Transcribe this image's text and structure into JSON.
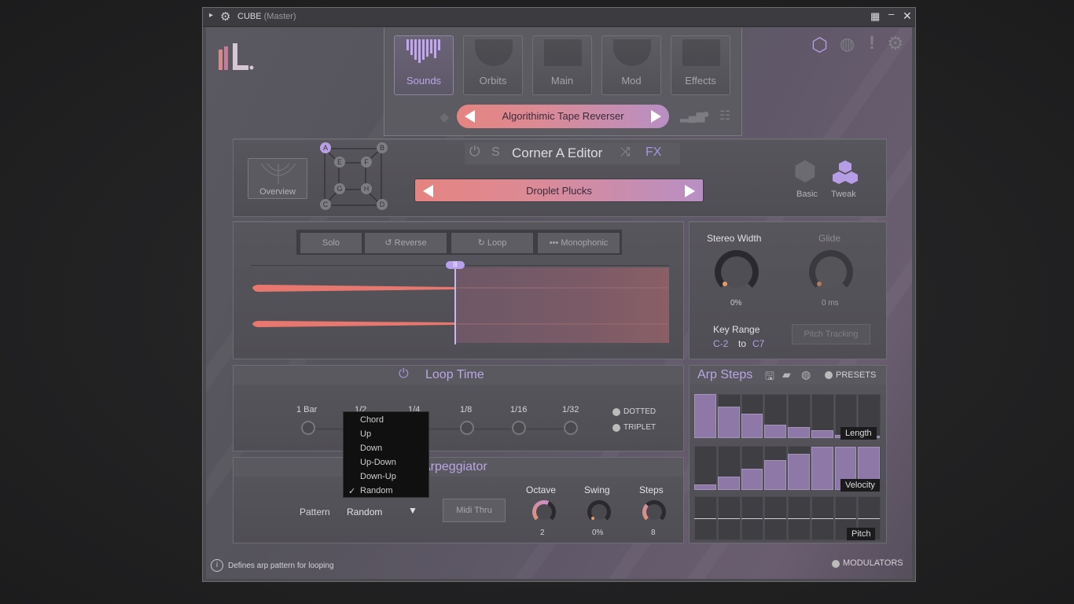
{
  "window": {
    "title": "CUBE",
    "subtitle": "(Master)"
  },
  "nav": {
    "tabs": [
      {
        "label": "Sounds",
        "active": true
      },
      {
        "label": "Orbits"
      },
      {
        "label": "Main"
      },
      {
        "label": "Mod"
      },
      {
        "label": "Effects"
      }
    ],
    "preset": "Algorithimic Tape Reverser"
  },
  "corner": {
    "s_label": "S",
    "title": "Corner A Editor",
    "fx_label": "FX",
    "overview_label": "Overview",
    "nodes": [
      "A",
      "B",
      "E",
      "F",
      "G",
      "H",
      "C",
      "D"
    ],
    "preset": "Droplet Plucks",
    "basic_label": "Basic",
    "tweak_label": "Tweak"
  },
  "sample": {
    "solo": "Solo",
    "reverse": "Reverse",
    "loop": "Loop",
    "mono": "Monophonic",
    "playhead_label": "|||"
  },
  "stereo": {
    "width_label": "Stereo Width",
    "width_value": "0%",
    "glide_label": "Glide",
    "glide_value": "0 ms",
    "key_range_label": "Key Range",
    "key_from": "C-2",
    "key_to_word": "to",
    "key_to": "C7",
    "pitch_tracking": "Pitch Tracking"
  },
  "loop": {
    "title": "Loop Time",
    "divisions": [
      "1 Bar",
      "1/2",
      "1/4",
      "1/8",
      "1/16",
      "1/32"
    ],
    "dotted": "DOTTED",
    "triplet": "TRIPLET"
  },
  "arp": {
    "title": "Arpeggiator",
    "pattern_label": "Pattern",
    "pattern_value": "Random",
    "dropdown_arrow": "▼",
    "midi_thru": "Midi Thru",
    "octave_label": "Octave",
    "octave_value": "2",
    "swing_label": "Swing",
    "swing_value": "0%",
    "steps_label": "Steps",
    "steps_value": "8",
    "menu": [
      {
        "label": "Chord"
      },
      {
        "label": "Up"
      },
      {
        "label": "Down"
      },
      {
        "label": "Up-Down"
      },
      {
        "label": "Down-Up"
      },
      {
        "label": "Random",
        "checked": true
      }
    ],
    "check": "✓"
  },
  "steps": {
    "title": "Arp Steps",
    "presets": "PRESETS",
    "length_label": "Length",
    "velocity_label": "Velocity",
    "pitch_label": "Pitch",
    "length": [
      1.0,
      0.72,
      0.55,
      0.3,
      0.25,
      0.18,
      0.08,
      0.05
    ],
    "velocity": [
      0.12,
      0.3,
      0.48,
      0.68,
      0.82,
      0.98,
      0.98,
      0.98
    ]
  },
  "footer": {
    "hint": "Defines arp pattern for looping",
    "modulators": "MODULATORS"
  },
  "colors": {
    "accent": "#b9a6e6",
    "preset_gradient_start": "#e58481",
    "preset_gradient_end": "#b88fc4",
    "waveform": "#e8776f"
  }
}
